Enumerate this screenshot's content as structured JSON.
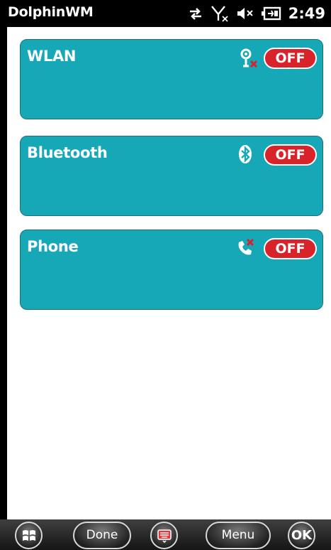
{
  "status_bar": {
    "app_title": "DolphinWM",
    "time": "2:49",
    "icons": [
      "data-sync-icon",
      "no-signal-icon",
      "speaker-muted-icon",
      "battery-charging-icon"
    ]
  },
  "tiles": [
    {
      "label": "WLAN",
      "icon": "wifi-off-icon",
      "toggle": "OFF"
    },
    {
      "label": "Bluetooth",
      "icon": "bluetooth-icon",
      "toggle": "OFF"
    },
    {
      "label": "Phone",
      "icon": "phone-off-icon",
      "toggle": "OFF"
    }
  ],
  "bottom_bar": {
    "start_icon": "windows-logo-icon",
    "done_label": "Done",
    "keyboard_icon": "keyboard-icon",
    "menu_label": "Menu",
    "ok_label": "OK"
  },
  "colors": {
    "tile_bg": "#17a8b8",
    "toggle_off": "#d9232b",
    "status_bg": "#000000"
  }
}
